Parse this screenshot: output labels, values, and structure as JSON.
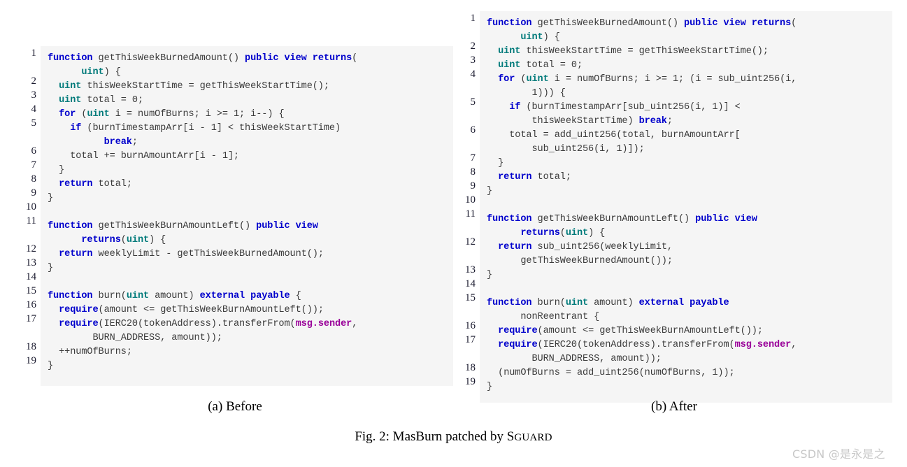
{
  "figure": {
    "caption_prefix": "Fig. 2: MasBurn patched by ",
    "caption_tool_first": "S",
    "caption_tool_rest": "GUARD",
    "caption_full": "Fig. 2: MasBurn patched by SGUARD"
  },
  "watermark": {
    "text": "CSDN @是永是之"
  },
  "colors": {
    "keyword": "#0000cc",
    "type": "#007a7a",
    "member": "#990099",
    "code_text": "#3b3b3b",
    "code_background": "#f5f5f5",
    "page_background": "#ffffff",
    "line_number": "#1a1a2e",
    "watermark": "#c8c8c8"
  },
  "panels": [
    {
      "id": "before",
      "subcaption": "(a) Before",
      "language": "solidity",
      "line_numbers": [
        "1",
        "2",
        "3",
        "4",
        "5",
        "6",
        "7",
        "8",
        "9",
        "10",
        "11",
        "12",
        "13",
        "14",
        "15",
        "16",
        "17",
        "18",
        "19"
      ],
      "line_number_rows": [
        0,
        2,
        3,
        4,
        5,
        7,
        8,
        9,
        10,
        11,
        12,
        14,
        15,
        16,
        17,
        18,
        19,
        21,
        22
      ],
      "code_lines": [
        "function getThisWeekBurnedAmount() public view returns(",
        "      uint) {",
        "  uint thisWeekStartTime = getThisWeekStartTime();",
        "  uint total = 0;",
        "  for (uint i = numOfBurns; i >= 1; i--) {",
        "    if (burnTimestampArr[i - 1] < thisWeekStartTime)",
        "          break;",
        "    total += burnAmountArr[i - 1];",
        "  }",
        "  return total;",
        "}",
        "",
        "function getThisWeekBurnAmountLeft() public view",
        "      returns(uint) {",
        "  return weeklyLimit - getThisWeekBurnedAmount();",
        "}",
        "",
        "function burn(uint amount) external payable {",
        "  require(amount <= getThisWeekBurnAmountLeft());",
        "  require(IERC20(tokenAddress).transferFrom(msg.sender,",
        "        BURN_ADDRESS, amount));",
        "  ++numOfBurns;",
        "}"
      ]
    },
    {
      "id": "after",
      "subcaption": "(b) After",
      "language": "solidity",
      "line_numbers": [
        "1",
        "2",
        "3",
        "4",
        "5",
        "6",
        "7",
        "8",
        "9",
        "10",
        "11",
        "12",
        "13",
        "14",
        "15",
        "16",
        "17",
        "18",
        "19"
      ],
      "line_number_rows": [
        0,
        2,
        3,
        4,
        6,
        8,
        10,
        11,
        12,
        13,
        14,
        16,
        18,
        19,
        20,
        22,
        23,
        25,
        26
      ],
      "code_lines": [
        "function getThisWeekBurnedAmount() public view returns(",
        "      uint) {",
        "  uint thisWeekStartTime = getThisWeekStartTime();",
        "  uint total = 0;",
        "  for (uint i = numOfBurns; i >= 1; (i = sub_uint256(i,",
        "        1))) {",
        "    if (burnTimestampArr[sub_uint256(i, 1)] <",
        "        thisWeekStartTime) break;",
        "    total = add_uint256(total, burnAmountArr[",
        "        sub_uint256(i, 1)]);",
        "  }",
        "  return total;",
        "}",
        "",
        "function getThisWeekBurnAmountLeft() public view",
        "      returns(uint) {",
        "  return sub_uint256(weeklyLimit,",
        "      getThisWeekBurnedAmount());",
        "}",
        "",
        "function burn(uint amount) external payable",
        "      nonReentrant {",
        "  require(amount <= getThisWeekBurnAmountLeft());",
        "  require(IERC20(tokenAddress).transferFrom(msg.sender,",
        "        BURN_ADDRESS, amount));",
        "  (numOfBurns = add_uint256(numOfBurns, 1));",
        "}"
      ]
    }
  ]
}
